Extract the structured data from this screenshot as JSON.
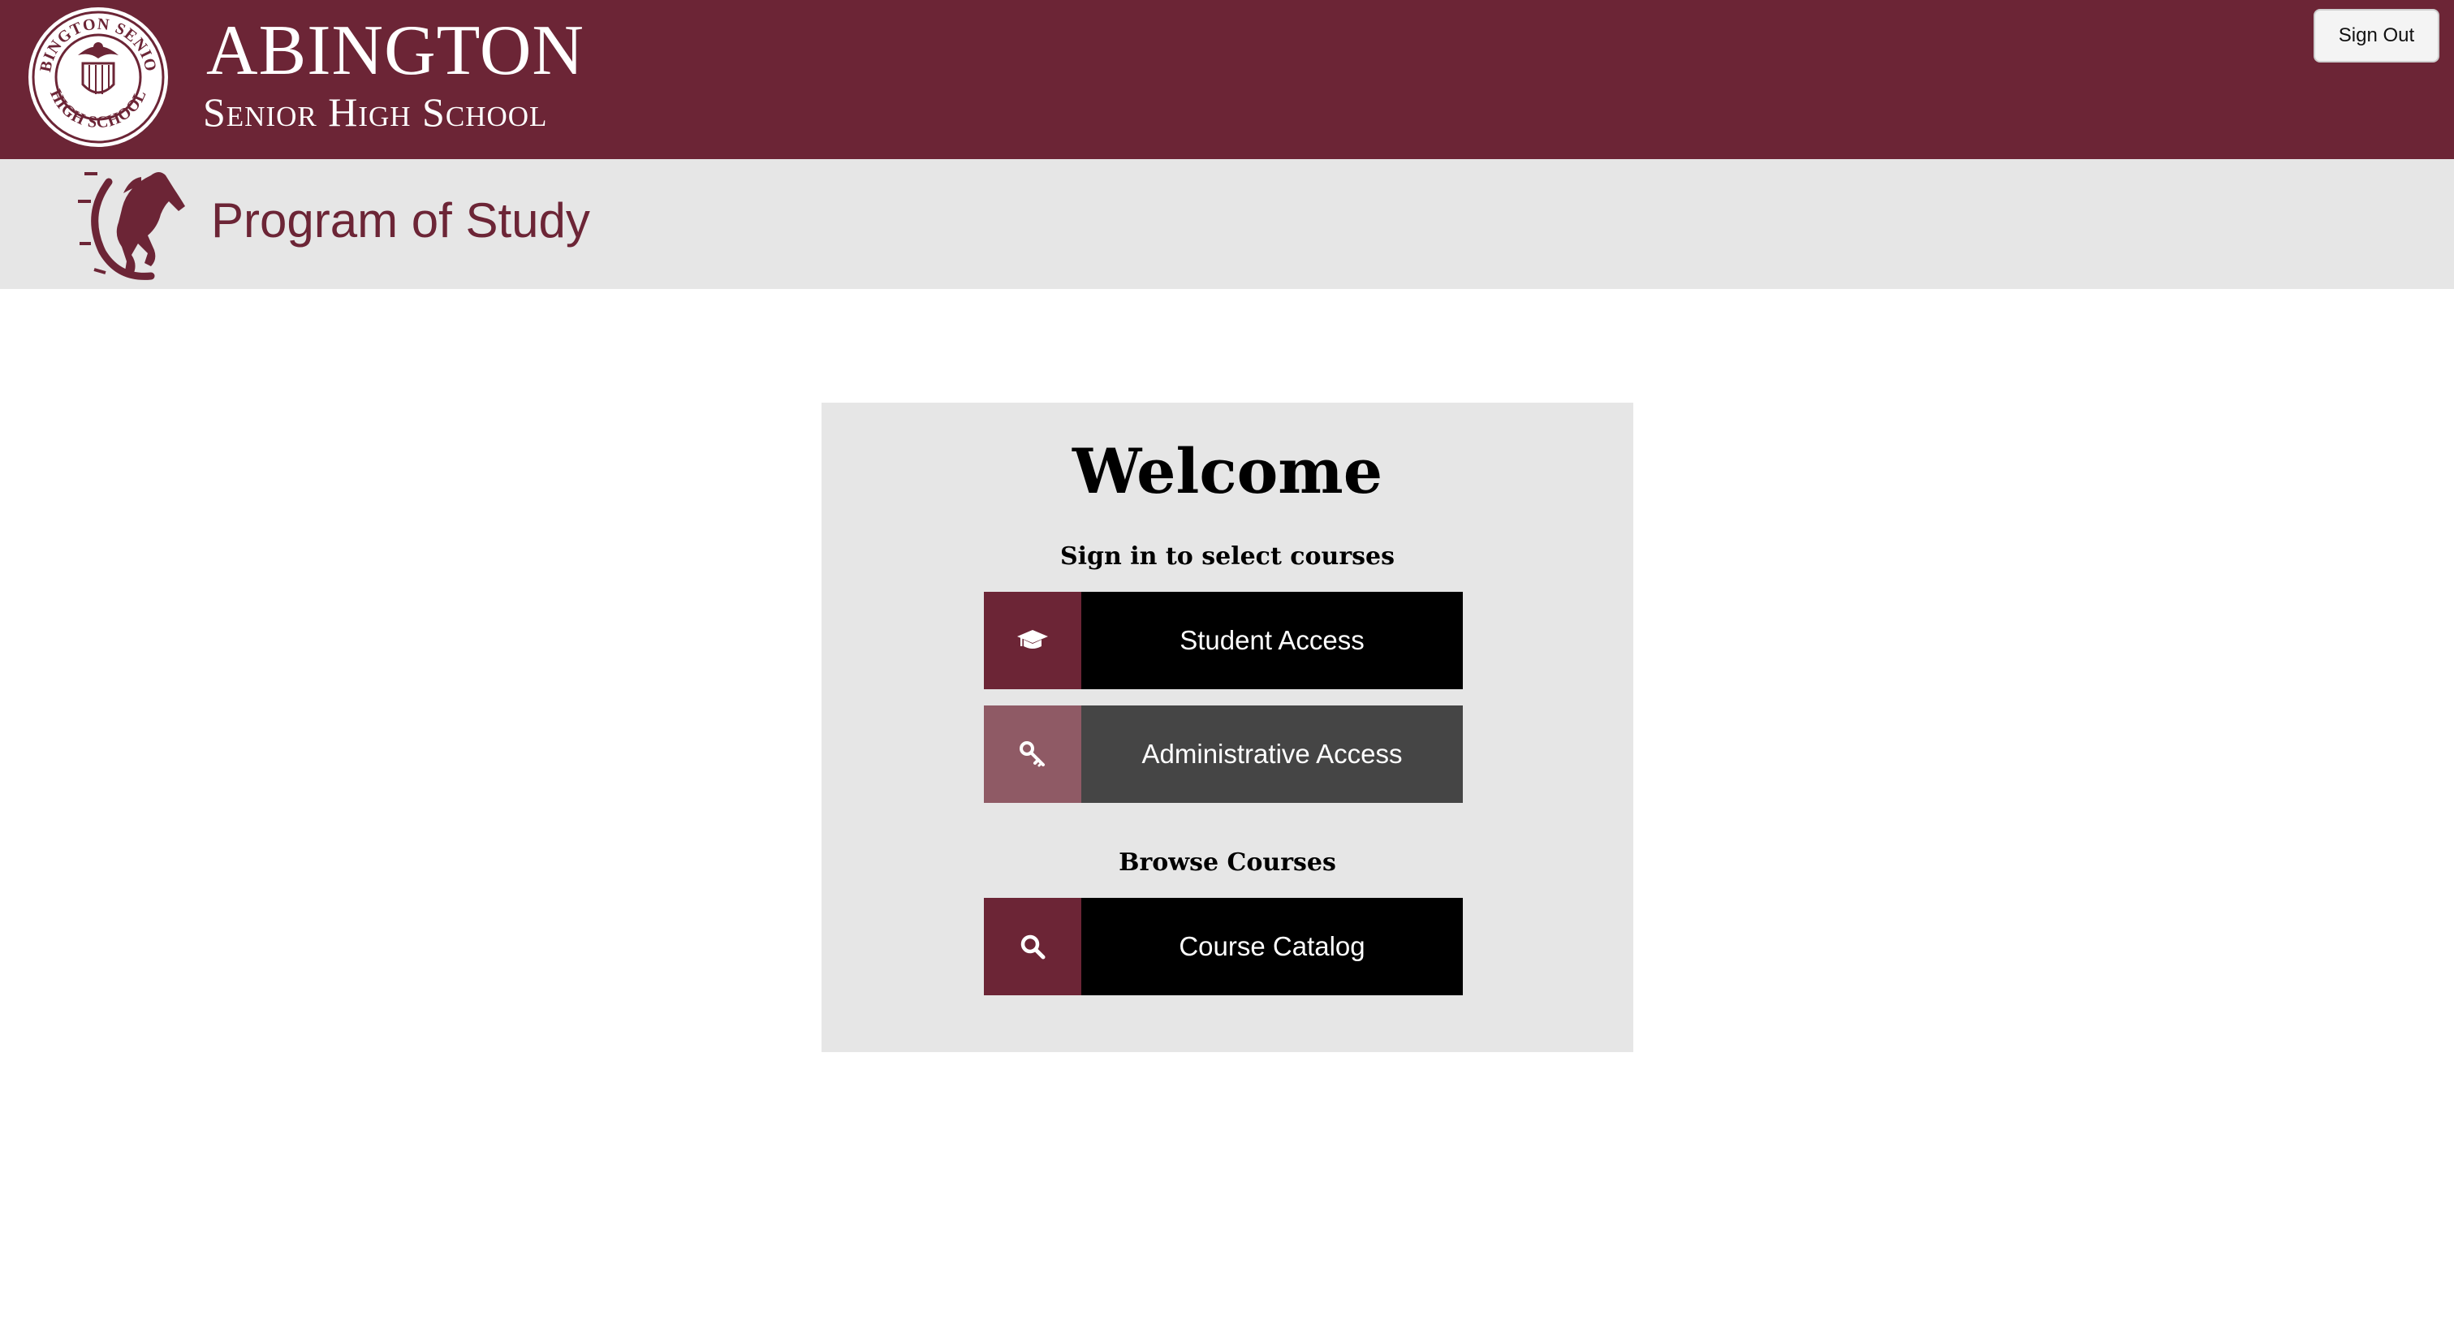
{
  "header": {
    "school_line1": "ABINGTON",
    "school_line2": "Senior High School",
    "seal_text": "ABINGTON SENIOR HIGH SCHOOL",
    "signout_label": "Sign Out"
  },
  "subheader": {
    "title": "Program of Study"
  },
  "card": {
    "welcome": "Welcome",
    "signin_label": "Sign in to select courses",
    "student_access": "Student Access",
    "admin_access": "Administrative Access",
    "browse_label": "Browse Courses",
    "course_catalog": "Course Catalog"
  },
  "icons": {
    "student": "graduation-cap-icon",
    "admin": "key-icon",
    "catalog": "search-icon"
  },
  "colors": {
    "brand_maroon": "#6c2536",
    "admin_icon_bg": "#8f5a65",
    "admin_label_bg": "#454545",
    "panel_gray": "#e6e6e6"
  }
}
